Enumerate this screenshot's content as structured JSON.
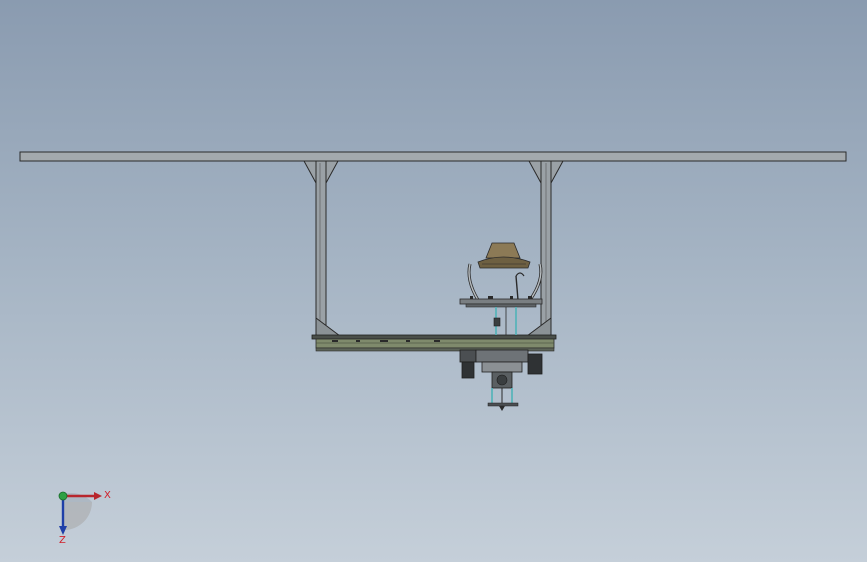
{
  "viewport": {
    "background_top": "#8a9bb0",
    "background_bottom": "#c5cfd9"
  },
  "model": {
    "line_color": "#2a2a2a",
    "steel_color": "#9aa1a6",
    "conveyor_color": "#7f8a6c",
    "accent_cyan": "#4fb3b8"
  },
  "triad": {
    "x_label": "X",
    "z_label": "Z",
    "x_color": "#b8262d",
    "y_color": "#2ea043",
    "z_color": "#1f3fa8"
  }
}
